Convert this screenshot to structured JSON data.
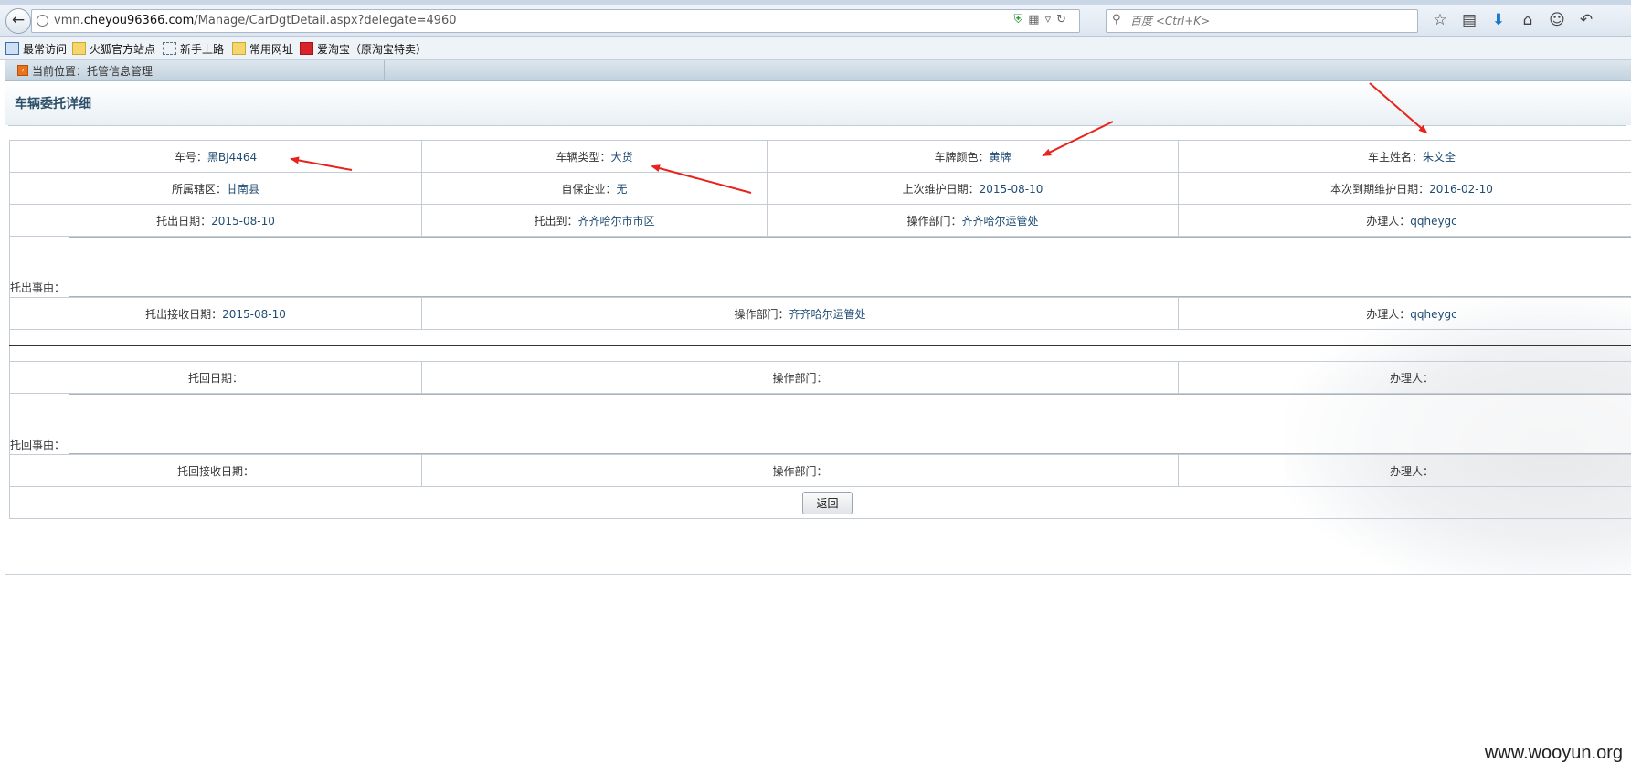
{
  "browser": {
    "url_prefix": "vmn.",
    "url_domain": "cheyou96366.com",
    "url_path": "/Manage/CarDgtDetail.aspx?delegate=4960",
    "search_placeholder": "百度 <Ctrl+K>",
    "back_glyph": "←",
    "toolbar_icons": [
      "star-icon",
      "reader-icon",
      "download-icon",
      "home-icon",
      "chat-icon",
      "undo-icon"
    ],
    "bookmarks": [
      {
        "label": "最常访问",
        "icon": "bookmark-blue-icon"
      },
      {
        "label": "火狐官方站点",
        "icon": "folder-icon"
      },
      {
        "label": "新手上路",
        "icon": "dashed-box-icon"
      },
      {
        "label": "常用网址",
        "icon": "folder-icon"
      },
      {
        "label": "爱淘宝（原淘宝特卖）",
        "icon": "taobao-icon"
      }
    ]
  },
  "location": "当前位置：托管信息管理",
  "page_title": "车辆委托详细",
  "rows": {
    "r1": [
      {
        "label": "车号：",
        "value": "黑BJ4464"
      },
      {
        "label": "车辆类型：",
        "value": "大货"
      },
      {
        "label": "车牌颜色：",
        "value": "黄牌"
      },
      {
        "label": "车主姓名：",
        "value": "朱文全"
      }
    ],
    "r2": [
      {
        "label": "所属辖区：",
        "value": "甘南县"
      },
      {
        "label": "自保企业：",
        "value": "无"
      },
      {
        "label": "上次维护日期：",
        "value": "2015-08-10"
      },
      {
        "label": "本次到期维护日期：",
        "value": "2016-02-10"
      }
    ],
    "r3": [
      {
        "label": "托出日期：",
        "value": "2015-08-10"
      },
      {
        "label": "托出到：",
        "value": "齐齐哈尔市市区"
      },
      {
        "label": "操作部门：",
        "value": "齐齐哈尔运管处"
      },
      {
        "label": "办理人：",
        "value": "qqheygc"
      }
    ],
    "out_reason_label": "托出事由：",
    "r4": [
      {
        "label": "托出接收日期：",
        "value": "2015-08-10"
      },
      {
        "label": "操作部门：",
        "value": "齐齐哈尔运管处"
      },
      {
        "label": "办理人：",
        "value": "qqheygc"
      }
    ],
    "r5": [
      {
        "label": "托回日期：",
        "value": ""
      },
      {
        "label": "操作部门：",
        "value": ""
      },
      {
        "label": "办理人：",
        "value": ""
      }
    ],
    "back_reason_label": "托回事由：",
    "r6": [
      {
        "label": "托回接收日期：",
        "value": ""
      },
      {
        "label": "操作部门：",
        "value": ""
      },
      {
        "label": "办理人：",
        "value": ""
      }
    ]
  },
  "return_button": "返回",
  "watermark": "www.wooyun.org",
  "colors": {
    "arrow": "#e8231c",
    "title": "#2c4f6a",
    "value": "#1f4c74"
  }
}
